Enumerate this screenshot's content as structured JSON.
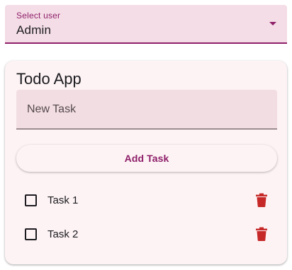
{
  "user_select": {
    "label": "Select user",
    "value": "Admin"
  },
  "card": {
    "title": "Todo App"
  },
  "new_task": {
    "placeholder": "New Task",
    "value": ""
  },
  "add_button": {
    "label": "Add Task"
  },
  "tasks": [
    {
      "label": "Task 1",
      "done": false
    },
    {
      "label": "Task 2",
      "done": false
    }
  ],
  "icons": {
    "dropdown": "dropdown-arrow-icon",
    "delete": "trash-icon",
    "checkbox": "checkbox-icon"
  },
  "colors": {
    "primary": "#8e1f6a",
    "delete": "#c62828",
    "field_bg": "#f4dde6",
    "card_bg": "#fdf3f4"
  }
}
